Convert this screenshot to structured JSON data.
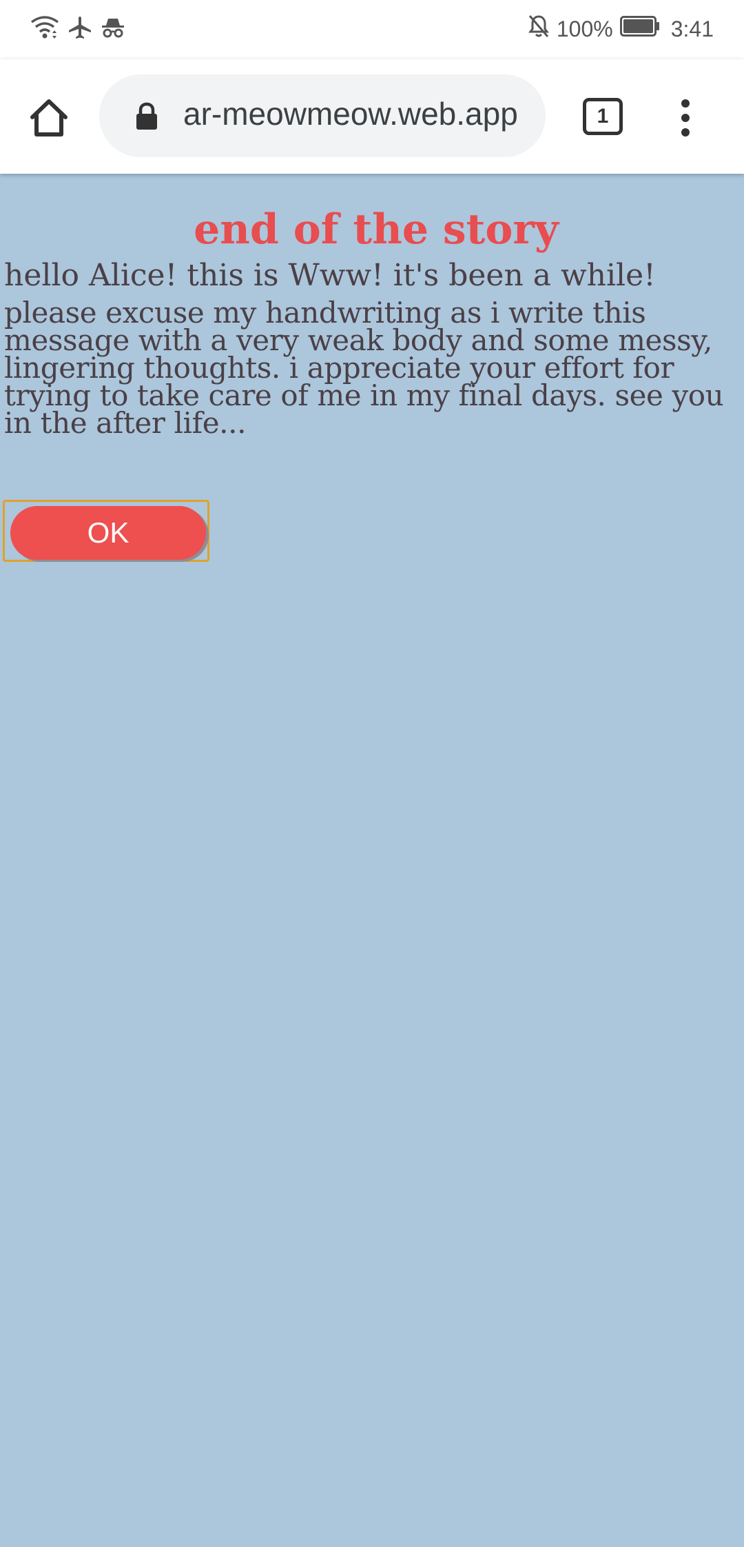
{
  "status_bar": {
    "battery_percent": "100%",
    "time": "3:41",
    "icons": [
      "wifi-icon",
      "airplane-icon",
      "incognito-icon",
      "bell-off-icon",
      "battery-icon"
    ]
  },
  "browser": {
    "url": "ar-meowmeow.web.app",
    "tab_count": "1",
    "icons": [
      "home-icon",
      "lock-icon",
      "tabs-icon",
      "more-vert-icon"
    ]
  },
  "page": {
    "title": "end of the story",
    "greeting": "hello Alice! this is Www! it's been a while!",
    "message": "please excuse my handwriting as i write this message with a very weak body and some messy, lingering thoughts. i appreciate your effort for trying to take care of me in my final days. see you in the after life...",
    "ok_label": "OK"
  },
  "colors": {
    "background": "#acc6dc",
    "title": "#e84d4f",
    "text": "#4a4046",
    "button": "#ee4f4f",
    "focus_outline": "#e0a12a"
  }
}
